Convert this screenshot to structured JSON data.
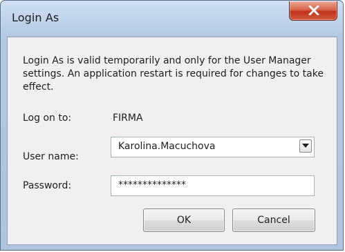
{
  "window": {
    "title": "Login As",
    "close_icon": "close-x-icon"
  },
  "dialog": {
    "info_text": "Login As is valid temporarily and only for the User Manager settings.  An application restart is required for changes to take effect.",
    "logon_label": "Log on to:",
    "logon_value": "FIRMA",
    "username_label": "User name:",
    "username_value": "Karolina.Macuchova",
    "dropdown_icon": "chevron-down-icon",
    "password_label": "Password:",
    "password_value": "**************",
    "ok_label": "OK",
    "cancel_label": "Cancel"
  },
  "colors": {
    "frame": "#aec4df",
    "client": "#f0f0f0",
    "close_button": "#c1321b"
  }
}
